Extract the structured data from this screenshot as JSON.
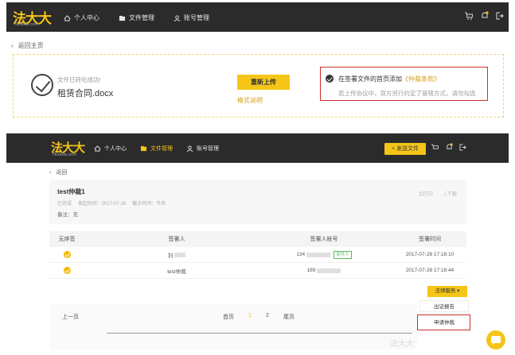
{
  "brand": {
    "logo_text": "法大大",
    "logo_sub": "Fadada.com"
  },
  "nav1": {
    "items": [
      {
        "label": "个人中心",
        "icon": "home-icon"
      },
      {
        "label": "文件管理",
        "icon": "folder-icon"
      },
      {
        "label": "账号管理",
        "icon": "user-icon"
      }
    ],
    "right_icons": [
      "cart-icon",
      "bell-icon",
      "logout-icon"
    ]
  },
  "upload": {
    "back_label": "返回主页",
    "status": "文件已转化成功!",
    "file_name": "租赁合同.docx",
    "reupload_label": "重新上传",
    "format_link": "格式说明",
    "seal_prefix": "在签署文件的首页添加",
    "seal_highlight": "《仲裁条款》",
    "seal_note": "若上传协议中，双方另行约定了管辖方式，请勿勾选"
  },
  "nav2": {
    "items": [
      {
        "label": "个人中心",
        "icon": "home-icon",
        "active": false
      },
      {
        "label": "文件管理",
        "icon": "folder-icon",
        "active": true
      },
      {
        "label": "账号管理",
        "icon": "user-icon",
        "active": false
      }
    ],
    "send_label": "发送文件",
    "send_icon_glyph": "+"
  },
  "detail": {
    "back_label": "返回",
    "title": "test仲裁1",
    "meta": [
      "已完成",
      "发起时间：2017-07-28",
      "截止时间：今天"
    ],
    "remark": "备注：无",
    "print_label": "打印",
    "download_label": "下载"
  },
  "table": {
    "headers": [
      "无序签",
      "签署人",
      "签署人帐号",
      "签署时间"
    ],
    "rows": [
      {
        "signer": "刘",
        "account": "134",
        "tag": "发件人",
        "time": "2017-07-28 17:18:10"
      },
      {
        "signer": "test仲裁",
        "account": "189",
        "tag": "",
        "time": "2017-07-28 17:18:44"
      }
    ]
  },
  "legal": {
    "button_label": "法律服务 ▾",
    "menu": [
      "出证报告",
      "申请仲裁"
    ]
  },
  "pager": {
    "prev": "上一页",
    "first": "首页",
    "pages": [
      "1",
      "2"
    ],
    "current": "1",
    "last": "尾页",
    "watermark": "法大大"
  },
  "colors": {
    "accent": "#f5c518",
    "nav_bg": "#2b2b2b",
    "highlight_border": "#c9302c"
  }
}
